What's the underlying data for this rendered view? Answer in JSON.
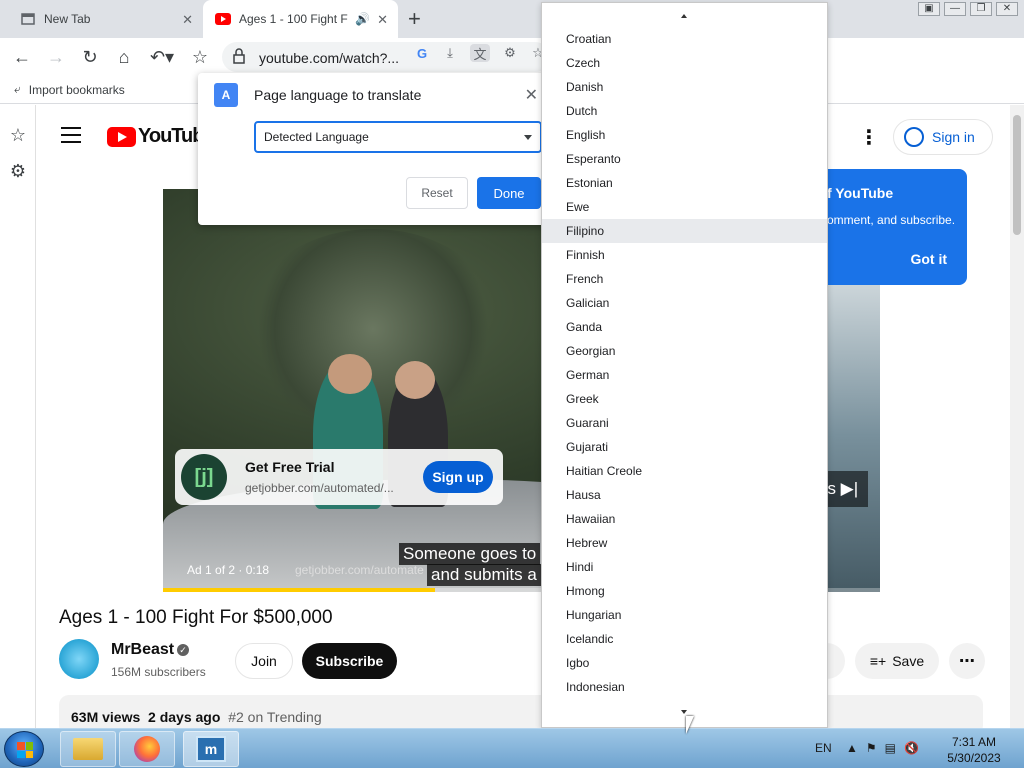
{
  "tabs": [
    {
      "title": "New Tab",
      "active": false
    },
    {
      "title": "Ages 1 - 100 Fight F",
      "active": true
    }
  ],
  "toolbar": {
    "url": "youtube.com/watch?..."
  },
  "bookmarks": {
    "import_label": "Import bookmarks"
  },
  "translate_popup": {
    "title": "Page language to translate",
    "selected_language": "Detected Language",
    "reset_label": "Reset",
    "done_label": "Done"
  },
  "languages": [
    "Croatian",
    "Czech",
    "Danish",
    "Dutch",
    "English",
    "Esperanto",
    "Estonian",
    "Ewe",
    "Filipino",
    "Finnish",
    "French",
    "Galician",
    "Ganda",
    "Georgian",
    "German",
    "Greek",
    "Guarani",
    "Gujarati",
    "Haitian Creole",
    "Hausa",
    "Hawaiian",
    "Hebrew",
    "Hindi",
    "Hmong",
    "Hungarian",
    "Icelandic",
    "Igbo",
    "Indonesian"
  ],
  "highlighted_language": "Filipino",
  "youtube": {
    "logo_text": "YouTube",
    "sign_in_label": "Sign in",
    "tip": {
      "title_fragment": "f YouTube",
      "body_fragment": "omment, and subscribe.",
      "got_it_label": "Got it"
    },
    "ad": {
      "headline": "Get Free Trial",
      "url": "getjobber.com/automated/...",
      "cta_label": "Sign up",
      "info": "Ad 1 of 2 · 0:18",
      "footer_url": "getjobber.com/automate",
      "skip_fragment": "ds ▶|",
      "progress_pct": 38
    },
    "captions": [
      "Someone goes to",
      "and submits a"
    ],
    "video_title": "Ages 1 - 100 Fight For $500,000",
    "channel": {
      "name": "MrBeast",
      "subscribers": "156M subscribers"
    },
    "join_label": "Join",
    "subscribe_label": "Subscribe",
    "share_fragment": "e",
    "save_label": "Save",
    "stats": {
      "views": "63M views",
      "age": "2 days ago",
      "trending": "#2 on Trending"
    }
  },
  "taskbar": {
    "language": "EN",
    "time": "7:31 AM",
    "date": "5/30/2023"
  }
}
